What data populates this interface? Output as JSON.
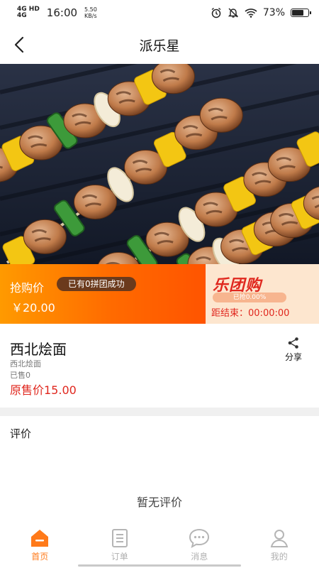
{
  "status_bar": {
    "signal_1": "4G HD",
    "signal_2": "4G",
    "time": "16:00",
    "net_speed": "5.50",
    "net_unit": "KB/s",
    "battery_text": "73%",
    "battery_level": 0.73
  },
  "nav": {
    "title": "派乐星"
  },
  "hero": {
    "image_alt": "grilled chicken skewers with peppers and onion"
  },
  "promo": {
    "label": "抢购价",
    "badge": "已有0拼团成功",
    "price": "￥20.00",
    "logo_text": "乐团购",
    "progress_text": "已抢0.00%",
    "progress_value": 0.0,
    "countdown_label": "距结束：",
    "countdown_time": "00:00:00",
    "colors": {
      "accent": "#ff6a00",
      "red": "#e0271e"
    }
  },
  "product": {
    "name": "西北烩面",
    "subtitle": "西北烩面",
    "sold": "已售0",
    "original_price": "原售价15.00",
    "share_label": "分享"
  },
  "reviews": {
    "title": "评价",
    "empty_text": "暂无评价"
  },
  "tabs": [
    {
      "label": "首页",
      "icon": "home-icon",
      "active": true
    },
    {
      "label": "订单",
      "icon": "order-icon",
      "active": false
    },
    {
      "label": "消息",
      "icon": "message-icon",
      "active": false
    },
    {
      "label": "我的",
      "icon": "profile-icon",
      "active": false
    }
  ]
}
